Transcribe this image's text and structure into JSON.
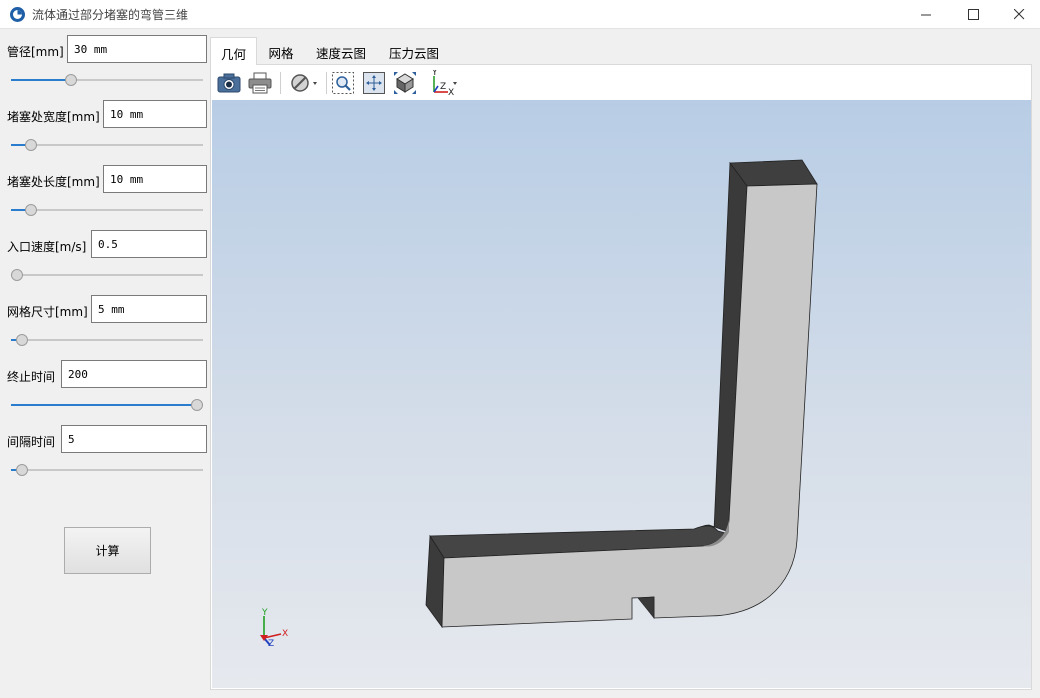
{
  "window": {
    "title": "流体通过部分堵塞的弯管三维",
    "controls": {
      "minimize": "—",
      "maximize": "☐",
      "close": "✕"
    }
  },
  "params": [
    {
      "label": "管径[mm]",
      "value": "30 mm",
      "slider": 0.3
    },
    {
      "label": "堵塞处宽度[mm]",
      "value": "10 mm",
      "slider": 0.08
    },
    {
      "label": "堵塞处长度[mm]",
      "value": "10 mm",
      "slider": 0.08
    },
    {
      "label": "入口速度[m/s]",
      "value": "0.5",
      "slider": 0.0
    },
    {
      "label": "网格尺寸[mm]",
      "value": "5 mm",
      "slider": 0.03
    },
    {
      "label": "终止时间",
      "value": "200",
      "slider": 1.0
    },
    {
      "label": "间隔时间",
      "value": "5",
      "slider": 0.03
    }
  ],
  "calculate_button": "计算",
  "tabs": [
    "几何",
    "网格",
    "速度云图",
    "压力云图"
  ],
  "active_tab": 0,
  "toolbar": {
    "icons": [
      "camera-icon",
      "print-icon",
      "hide-icon",
      "zoom-box-icon",
      "fit-all-icon",
      "view-box-icon",
      "axes-icon"
    ]
  },
  "axes_triad": {
    "x": "X",
    "y": "Y",
    "z": "Z"
  },
  "colors": {
    "viewport_top": "#b8cde5",
    "viewport_bottom": "#e6e9ee",
    "slider_fill": "#2a7ccf",
    "model_face_light": "#c6c6c6",
    "model_face_dark": "#3c3c3c"
  }
}
